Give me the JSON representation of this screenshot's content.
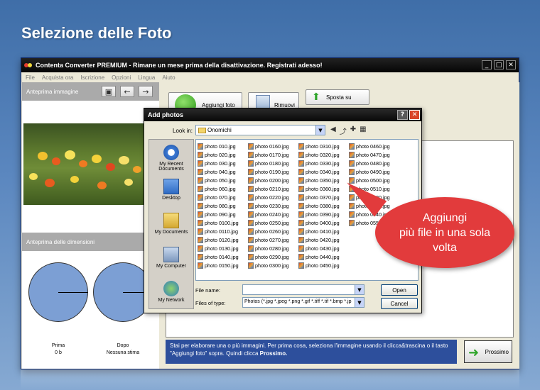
{
  "banner": {
    "title": "Selezione delle Foto"
  },
  "app": {
    "title": "Contenta Converter PREMIUM  - Rimane un mese prima della disattivazione. Registrati adesso!",
    "window_controls": [
      "_",
      "□",
      "✕"
    ],
    "menu": [
      "File",
      "Acquista ora",
      "Iscrizione",
      "Opzioni",
      "Lingua",
      "Aiuto"
    ]
  },
  "left": {
    "preview_header": "Anteprima immagine",
    "size_header": "Anteprima delle dimensioni",
    "before": {
      "label": "Prima",
      "value": "0 b"
    },
    "after": {
      "label": "Dopo",
      "value": "Nessuna stima"
    }
  },
  "toolbar": {
    "add_label": "Aggiungi foto",
    "remove_label": "Rimuovi",
    "move_up_label": "Sposta su"
  },
  "info": {
    "text": "Stai per elaborare una o più immagini. Per prima cosa, seleziona l'immagine usando il clicca&trascina o il tasto \"Aggiungi foto\" sopra. Quindi clicca ",
    "bold": "Prossimo."
  },
  "next_button": "Prossimo",
  "dialog": {
    "title": "Add photos",
    "help": "?",
    "close": "✕",
    "look_in_label": "Look in:",
    "look_in_value": "Onomichi",
    "places": [
      "My Recent Documents",
      "Desktop",
      "My Documents",
      "My Computer",
      "My Network"
    ],
    "files": [
      [
        "photo 010.jpg",
        "photo 020.jpg",
        "photo 030.jpg",
        "photo 040.jpg",
        "photo 050.jpg",
        "photo 060.jpg",
        "photo 070.jpg",
        "photo 080.jpg",
        "photo 090.jpg",
        "photo 0100.jpg",
        "photo 0110.jpg",
        "photo 0120.jpg",
        "photo 0130.jpg",
        "photo 0140.jpg",
        "photo 0150.jpg"
      ],
      [
        "photo 0160.jpg",
        "photo 0170.jpg",
        "photo 0180.jpg",
        "photo 0190.jpg",
        "photo 0200.jpg",
        "photo 0210.jpg",
        "photo 0220.jpg",
        "photo 0230.jpg",
        "photo 0240.jpg",
        "photo 0250.jpg",
        "photo 0260.jpg",
        "photo 0270.jpg",
        "photo 0280.jpg",
        "photo 0290.jpg",
        "photo 0300.jpg"
      ],
      [
        "photo 0310.jpg",
        "photo 0320.jpg",
        "photo 0330.jpg",
        "photo 0340.jpg",
        "photo 0350.jpg",
        "photo 0360.jpg",
        "photo 0370.jpg",
        "photo 0380.jpg",
        "photo 0390.jpg",
        "photo 0400.jpg",
        "photo 0410.jpg",
        "photo 0420.jpg",
        "photo 0430.jpg",
        "photo 0440.jpg",
        "photo 0450.jpg"
      ],
      [
        "photo 0460.jpg",
        "photo 0470.jpg",
        "photo 0480.jpg",
        "photo 0490.jpg",
        "photo 0500.jpg",
        "photo 0510.jpg",
        "photo 0520.jpg",
        "photo 0530.jpg",
        "photo 0540.jpg",
        "photo 0550.jpg"
      ]
    ],
    "file_name_label": "File name:",
    "file_name_value": "",
    "files_type_label": "Files of type:",
    "files_type_value": "Photos (*.jpg *.jpeg *.png *.gif *.tiff *.tif *.bmp *.jp",
    "open_label": "Open",
    "cancel_label": "Cancel"
  },
  "callout": {
    "line1": "Aggiungi",
    "line2": "più file in una sola",
    "line3": "volta"
  },
  "colors": {
    "accent": "#2d4f9c",
    "callout": "#e23b3c",
    "pie": "#7c9fd4"
  }
}
